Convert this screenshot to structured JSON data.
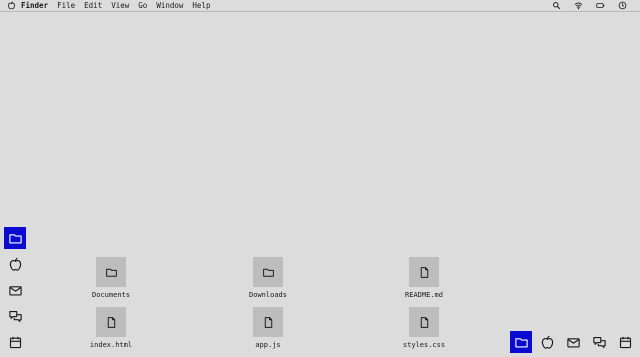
{
  "menubar": {
    "app_icon": "apple-icon",
    "menus": [
      "Finder",
      "File",
      "Edit",
      "View",
      "Go",
      "Window",
      "Help"
    ],
    "status_icons": [
      "search-icon",
      "wifi-icon",
      "battery-icon",
      "clock-icon"
    ]
  },
  "side_dock": [
    {
      "icon": "folder-icon",
      "active": true
    },
    {
      "icon": "apple-icon",
      "active": false
    },
    {
      "icon": "mail-icon",
      "active": false
    },
    {
      "icon": "chat-icon",
      "active": false
    },
    {
      "icon": "calendar-icon",
      "active": false
    }
  ],
  "bottom_dock": [
    {
      "icon": "folder-icon",
      "active": true
    },
    {
      "icon": "apple-icon",
      "active": false
    },
    {
      "icon": "mail-icon",
      "active": false
    },
    {
      "icon": "chat-icon",
      "active": false
    },
    {
      "icon": "calendar-icon",
      "active": false
    }
  ],
  "desktop": {
    "files": [
      {
        "name": "Documents",
        "type": "folder"
      },
      {
        "name": "Downloads",
        "type": "folder"
      },
      {
        "name": "README.md",
        "type": "file"
      },
      {
        "name": "index.html",
        "type": "file"
      },
      {
        "name": "app.js",
        "type": "file"
      },
      {
        "name": "styles.css",
        "type": "file"
      }
    ]
  },
  "colors": {
    "background": "#dcdcdc",
    "accent": "#0a0ad0",
    "tile": "#bdbdbd"
  }
}
